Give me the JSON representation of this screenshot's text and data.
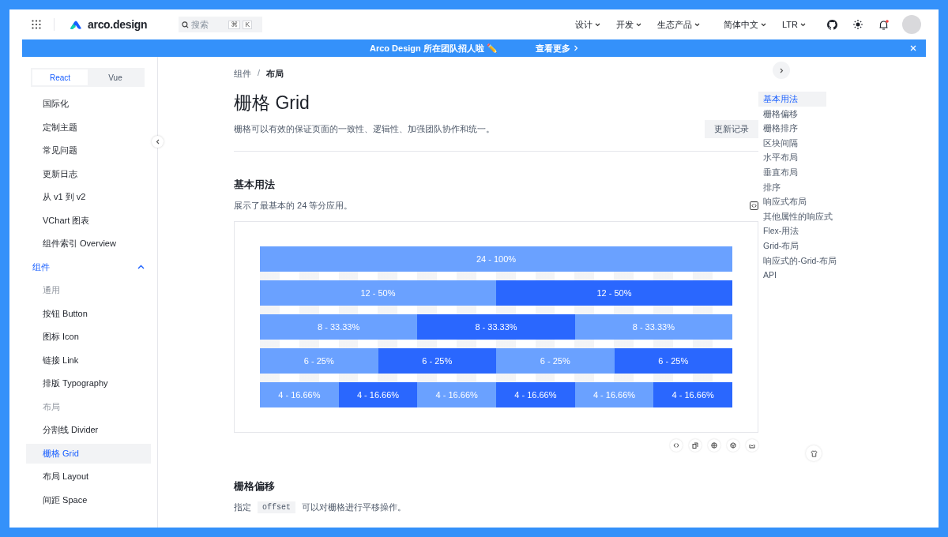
{
  "header": {
    "logo": "arco.design",
    "search": {
      "placeholder": "搜索",
      "keys": [
        "⌘",
        "K"
      ]
    },
    "nav": [
      {
        "label": "设计"
      },
      {
        "label": "开发"
      },
      {
        "label": "生态产品"
      },
      {
        "label": "简体中文"
      },
      {
        "label": "LTR"
      }
    ],
    "notification_unread": true
  },
  "banner": {
    "text": "Arco Design 所在团队招人啦 ✏️",
    "link": "查看更多"
  },
  "sidebar": {
    "tabs": [
      {
        "label": "React",
        "selected": true
      },
      {
        "label": "Vue",
        "selected": false
      }
    ],
    "items": [
      {
        "kind": "item",
        "label": "国际化",
        "selected": false
      },
      {
        "kind": "item",
        "label": "定制主题",
        "selected": false
      },
      {
        "kind": "item",
        "label": "常见问题",
        "selected": false
      },
      {
        "kind": "item",
        "label": "更新日志",
        "selected": false
      },
      {
        "kind": "item",
        "label": "从 v1 到 v2",
        "selected": false
      },
      {
        "kind": "item",
        "label": "VChart 图表",
        "selected": false
      },
      {
        "kind": "item",
        "label": "组件索引 Overview",
        "selected": false
      },
      {
        "kind": "group",
        "label": "组件",
        "expanded": true
      },
      {
        "kind": "caption",
        "label": "通用"
      },
      {
        "kind": "item",
        "label": "按钮 Button",
        "selected": false
      },
      {
        "kind": "item",
        "label": "图标 Icon",
        "selected": false
      },
      {
        "kind": "item",
        "label": "链接 Link",
        "selected": false
      },
      {
        "kind": "item",
        "label": "排版 Typography",
        "selected": false
      },
      {
        "kind": "caption",
        "label": "布局"
      },
      {
        "kind": "item",
        "label": "分割线 Divider",
        "selected": false
      },
      {
        "kind": "item",
        "label": "栅格 Grid",
        "selected": true
      },
      {
        "kind": "item",
        "label": "布局 Layout",
        "selected": false
      },
      {
        "kind": "item",
        "label": "间距 Space",
        "selected": false
      }
    ]
  },
  "breadcrumb": [
    "组件",
    "布局"
  ],
  "breadcrumb_separator": "/",
  "title": "栅格 Grid",
  "description": "栅格可以有效的保证页面的一致性、逻辑性、加强团队协作和统一。",
  "changelog_button": "更新记录",
  "sections": [
    {
      "title": "基本用法",
      "description": "展示了最基本的 24 等分应用。",
      "demo_rows": [
        {
          "columns": [
            {
              "label": "24 - 100%",
              "dark": false
            }
          ]
        },
        {
          "columns": [
            {
              "label": "12 - 50%",
              "dark": false
            },
            {
              "label": "12 - 50%",
              "dark": true
            }
          ]
        },
        {
          "columns": [
            {
              "label": "8 - 33.33%",
              "dark": false
            },
            {
              "label": "8 - 33.33%",
              "dark": true
            },
            {
              "label": "8 - 33.33%",
              "dark": false
            }
          ]
        },
        {
          "columns": [
            {
              "label": "6 - 25%",
              "dark": false
            },
            {
              "label": "6 - 25%",
              "dark": true
            },
            {
              "label": "6 - 25%",
              "dark": false
            },
            {
              "label": "6 - 25%",
              "dark": true
            }
          ]
        },
        {
          "columns": [
            {
              "label": "4 - 16.66%",
              "dark": false
            },
            {
              "label": "4 - 16.66%",
              "dark": true
            },
            {
              "label": "4 - 16.66%",
              "dark": false
            },
            {
              "label": "4 - 16.66%",
              "dark": true
            },
            {
              "label": "4 - 16.66%",
              "dark": false
            },
            {
              "label": "4 - 16.66%",
              "dark": true
            }
          ]
        }
      ]
    },
    {
      "title": "栅格偏移",
      "description_before": "指定",
      "code": "offset",
      "description_after": "可以对栅格进行平移操作。"
    }
  ],
  "toc": [
    {
      "label": "基本用法",
      "selected": true
    },
    {
      "label": "栅格偏移",
      "selected": false
    },
    {
      "label": "栅格排序",
      "selected": false
    },
    {
      "label": "区块间隔",
      "selected": false
    },
    {
      "label": "水平布局",
      "selected": false
    },
    {
      "label": "垂直布局",
      "selected": false
    },
    {
      "label": "排序",
      "selected": false
    },
    {
      "label": "响应式布局",
      "selected": false
    },
    {
      "label": "其他属性的响应式",
      "selected": false
    },
    {
      "label": "Flex-用法",
      "selected": false
    },
    {
      "label": "Grid-布局",
      "selected": false
    },
    {
      "label": "响应式的-Grid-布局",
      "selected": false
    },
    {
      "label": "API",
      "selected": false
    }
  ]
}
